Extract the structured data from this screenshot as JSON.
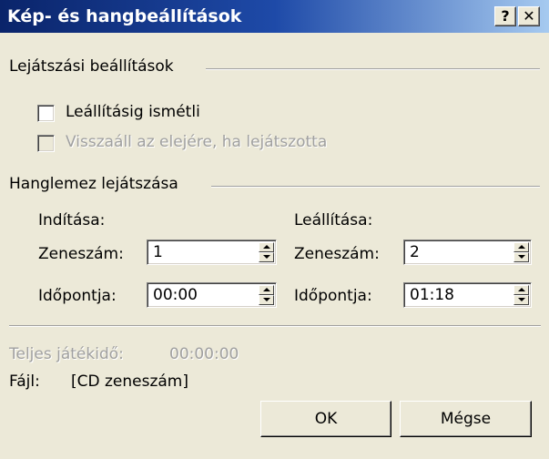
{
  "window": {
    "title": "Kép- és hangbeállítások",
    "help_label": "?",
    "close_label": "✕"
  },
  "playback_settings": {
    "group_label": "Lejátszási beállítások",
    "loop": {
      "label": "Leállításig ismétli",
      "checked": false,
      "enabled": true
    },
    "rewind": {
      "label": "Visszaáll az elejére, ha lejátszotta",
      "checked": false,
      "enabled": false
    }
  },
  "cd_playback": {
    "group_label": "Hanglemez lejátszása",
    "start": {
      "heading": "Indítása:",
      "track_label": "Zeneszám:",
      "track_value": "1",
      "time_label": "Időpontja:",
      "time_value": "00:00"
    },
    "stop": {
      "heading": "Leállítása:",
      "track_label": "Zeneszám:",
      "track_value": "2",
      "time_label": "Időpontja:",
      "time_value": "01:18"
    }
  },
  "info": {
    "total_time_label": "Teljes játékidő:",
    "total_time_value": "00:00:00",
    "file_label": "Fájl:",
    "file_value": "[CD zeneszám]"
  },
  "buttons": {
    "ok_label": "OK",
    "cancel_label": "Mégse"
  },
  "colors": {
    "titlebar": "#0a246a",
    "face": "#ece9d8",
    "disabled_text": "#a0a0a0"
  }
}
